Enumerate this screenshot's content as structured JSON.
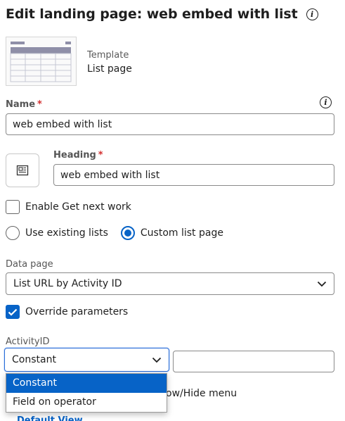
{
  "header": {
    "title": "Edit landing page: web embed with list"
  },
  "template": {
    "caption": "Template",
    "name": "List page"
  },
  "name_field": {
    "label": "Name",
    "required_mark": "*",
    "value": "web embed with list"
  },
  "heading_field": {
    "label": "Heading",
    "required_mark": "*",
    "value": "web embed with list"
  },
  "enable_get_next_work": {
    "label": "Enable Get next work",
    "checked": false
  },
  "list_source": {
    "options": [
      {
        "label": "Use existing lists",
        "selected": false
      },
      {
        "label": "Custom list page",
        "selected": true
      }
    ]
  },
  "data_page": {
    "label": "Data page",
    "value": "List URL by Activity ID"
  },
  "override_parameters": {
    "label": "Override parameters",
    "checked": true
  },
  "activity_id": {
    "label": "ActivityID",
    "source_value": "Constant",
    "value": "",
    "dropdown_options": [
      {
        "label": "Constant",
        "active": true
      },
      {
        "label": "Field on operator",
        "active": false
      }
    ]
  },
  "partial_behind": {
    "text": "ow/Hide menu"
  },
  "cut_off": {
    "text": "Default View"
  },
  "colors": {
    "accent": "#0763c7",
    "required": "#d32f2f",
    "focus_border": "#2b6dd6"
  }
}
